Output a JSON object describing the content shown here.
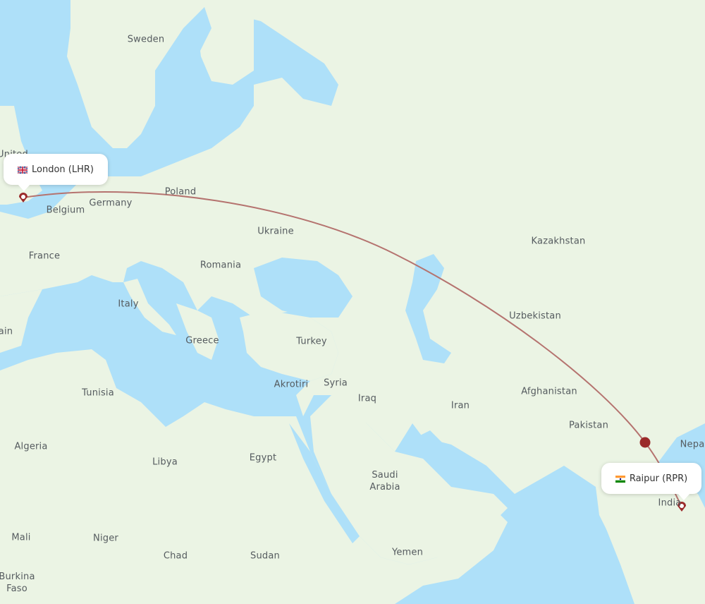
{
  "route": {
    "origin": {
      "city": "London",
      "code": "LHR",
      "label": "London (LHR)",
      "flag": "uk-flag-icon"
    },
    "destination": {
      "city": "Raipur",
      "code": "RPR",
      "label": "Raipur (RPR)",
      "flag": "india-flag-icon"
    },
    "line_color": "#b5736f",
    "marker_color": "#9b2a2a"
  },
  "country_labels": [
    {
      "name": "Sweden"
    },
    {
      "name": "United"
    },
    {
      "name": "Poland"
    },
    {
      "name": "Germany"
    },
    {
      "name": "Belgium"
    },
    {
      "name": "France"
    },
    {
      "name": "Ukraine"
    },
    {
      "name": "Romania"
    },
    {
      "name": "Kazakhstan"
    },
    {
      "name": "Italy"
    },
    {
      "name": "Greece"
    },
    {
      "name": "Turkey"
    },
    {
      "name": "Uzbekistan"
    },
    {
      "name": "ain"
    },
    {
      "name": "Akrotiri"
    },
    {
      "name": "Syria"
    },
    {
      "name": "Tunisia"
    },
    {
      "name": "Iraq"
    },
    {
      "name": "Iran"
    },
    {
      "name": "Afghanistan"
    },
    {
      "name": "Pakistan"
    },
    {
      "name": "Algeria"
    },
    {
      "name": "Libya"
    },
    {
      "name": "Egypt"
    },
    {
      "name": "Nepa"
    },
    {
      "name": "Saudi\nArabia"
    },
    {
      "name": "India"
    },
    {
      "name": "Mali"
    },
    {
      "name": "Niger"
    },
    {
      "name": "Chad"
    },
    {
      "name": "Sudan"
    },
    {
      "name": "Yemen"
    },
    {
      "name": "Burkina\nFaso"
    }
  ],
  "colors": {
    "water": "#aee0f9",
    "land": "#ebf4e4",
    "border": "#9ccf95"
  }
}
